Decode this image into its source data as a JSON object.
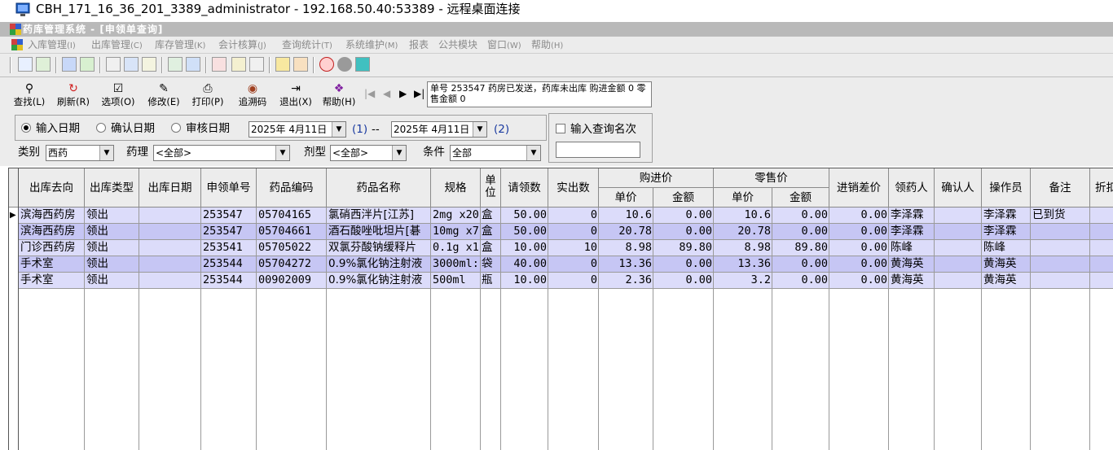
{
  "rdp": {
    "title": "CBH_171_16_36_201_3389_administrator - 192.168.50.40:53389 - 远程桌面连接"
  },
  "app": {
    "title": "药库管理系统 - [申领单查询]"
  },
  "menu": [
    {
      "label": "入库管理",
      "key": "(I)"
    },
    {
      "label": "出库管理",
      "key": "(C)"
    },
    {
      "label": "库存管理",
      "key": "(K)"
    },
    {
      "label": "会计核算",
      "key": "(J)"
    },
    {
      "label": "查询统计",
      "key": "(T)"
    },
    {
      "label": "系统维护",
      "key": "(M)"
    },
    {
      "label": "报表",
      "key": ""
    },
    {
      "label": "公共模块",
      "key": ""
    },
    {
      "label": "窗口",
      "key": "(W)"
    },
    {
      "label": "帮助",
      "key": "(H)"
    }
  ],
  "toolbar": [
    {
      "label": "查找(L)",
      "icon": "search-icon",
      "glyph": "⚲"
    },
    {
      "label": "刷新(R)",
      "icon": "refresh-icon",
      "glyph": "↻"
    },
    {
      "label": "选项(O)",
      "icon": "options-icon",
      "glyph": "☑"
    },
    {
      "label": "修改(E)",
      "icon": "edit-icon",
      "glyph": "✎"
    },
    {
      "label": "打印(P)",
      "icon": "print-icon",
      "glyph": "⎙"
    },
    {
      "label": "追溯码",
      "icon": "trace-code-icon",
      "glyph": "◉"
    },
    {
      "label": "退出(X)",
      "icon": "exit-icon",
      "glyph": "⇥"
    },
    {
      "label": "帮助(H)",
      "icon": "help-book-icon",
      "glyph": "❖"
    }
  ],
  "nav": {
    "first": "|◀",
    "prev": "◀",
    "next": "▶",
    "last": "▶|"
  },
  "status": {
    "text": "单号 253547 药房已发送，药库未出库 购进金额 0 零售金额 0"
  },
  "filter": {
    "radio_input": "输入日期",
    "radio_confirm": "确认日期",
    "radio_audit": "审核日期",
    "date1": "2025年 4月11日",
    "date1_tag": "(1)",
    "dash": "--",
    "date2": "2025年 4月11日",
    "date2_tag": "(2)",
    "query_label": "输入查询名次",
    "query_value": "",
    "category_label": "类别",
    "category_value": "西药",
    "pharm_label": "药理",
    "pharm_value": "<全部>",
    "form_label": "剂型",
    "form_value": "<全部>",
    "cond_label": "条件",
    "cond_value": "全部"
  },
  "table": {
    "headers": {
      "dest": "出库去向",
      "type": "出库类型",
      "date": "出库日期",
      "req_no": "申领单号",
      "code": "药品编码",
      "name": "药品名称",
      "spec": "规格",
      "unit": "单位",
      "req_qty": "请领数",
      "out_qty": "实出数",
      "purchase": "购进价",
      "p_price": "单价",
      "p_amount": "金额",
      "retail": "零售价",
      "r_price": "单价",
      "r_amount": "金额",
      "diff": "进销差价",
      "receiver": "领药人",
      "confirmer": "确认人",
      "operator": "操作员",
      "remark": "备注",
      "discount": "折扣"
    },
    "rows": [
      {
        "dest": "滨海西药房",
        "type": "领出",
        "date": "",
        "req_no": "253547",
        "code": "05704165",
        "name": "氯硝西泮片[江苏]",
        "spec": "2mg x20",
        "unit": "盒",
        "req_qty": "50.00",
        "out_qty": "0",
        "p_price": "10.6",
        "p_amount": "0.00",
        "r_price": "10.6",
        "r_amount": "0.00",
        "diff": "0.00",
        "receiver": "李泽霖",
        "confirmer": "",
        "operator": "李泽霖",
        "remark": "已到货"
      },
      {
        "dest": "滨海西药房",
        "type": "领出",
        "date": "",
        "req_no": "253547",
        "code": "05704661",
        "name": "酒石酸唑吡坦片[碁",
        "spec": "10mg x7",
        "unit": "盒",
        "req_qty": "50.00",
        "out_qty": "0",
        "p_price": "20.78",
        "p_amount": "0.00",
        "r_price": "20.78",
        "r_amount": "0.00",
        "diff": "0.00",
        "receiver": "李泽霖",
        "confirmer": "",
        "operator": "李泽霖",
        "remark": ""
      },
      {
        "dest": "门诊西药房",
        "type": "领出",
        "date": "",
        "req_no": "253541",
        "code": "05705022",
        "name": "双氯芬酸钠缓释片",
        "spec": "0.1g x1",
        "unit": "盒",
        "req_qty": "10.00",
        "out_qty": "10",
        "p_price": "8.98",
        "p_amount": "89.80",
        "r_price": "8.98",
        "r_amount": "89.80",
        "diff": "0.00",
        "receiver": "陈峰",
        "confirmer": "",
        "operator": "陈峰",
        "remark": ""
      },
      {
        "dest": "手术室",
        "type": "领出",
        "date": "",
        "req_no": "253544",
        "code": "05704272",
        "name": "0.9%氯化钠注射液",
        "spec": "3000ml:",
        "unit": "袋",
        "req_qty": "40.00",
        "out_qty": "0",
        "p_price": "13.36",
        "p_amount": "0.00",
        "r_price": "13.36",
        "r_amount": "0.00",
        "diff": "0.00",
        "receiver": "黄海英",
        "confirmer": "",
        "operator": "黄海英",
        "remark": ""
      },
      {
        "dest": "手术室",
        "type": "领出",
        "date": "",
        "req_no": "253544",
        "code": "00902009",
        "name": "0.9%氯化钠注射液",
        "spec": "500ml",
        "unit": "瓶",
        "req_qty": "10.00",
        "out_qty": "0",
        "p_price": "2.36",
        "p_amount": "0.00",
        "r_price": "3.2",
        "r_amount": "0.00",
        "diff": "0.00",
        "receiver": "黄海英",
        "confirmer": "",
        "operator": "黄海英",
        "remark": ""
      }
    ]
  },
  "colors": {
    "row_even": "#dcdcfa",
    "row_odd": "#c6c6f4",
    "header_bg": "#ececec",
    "titlebar": "#b9b9b9"
  }
}
